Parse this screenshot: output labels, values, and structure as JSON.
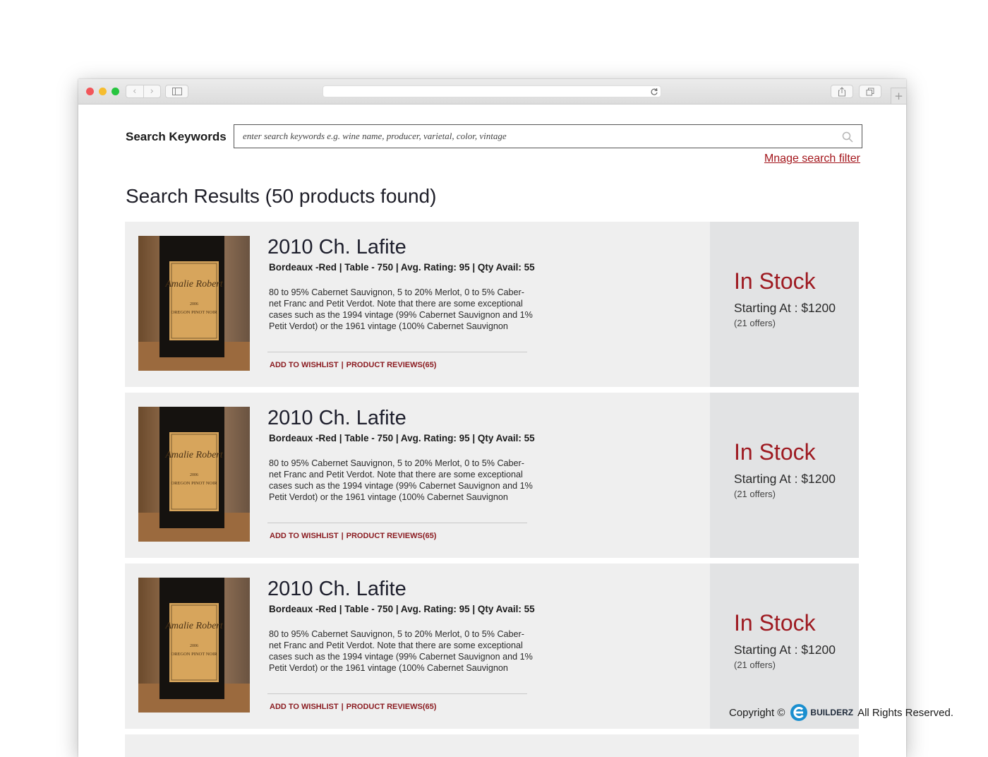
{
  "browser": {
    "controls": {
      "back": "‹",
      "forward": "›",
      "new_tab": "+"
    }
  },
  "search": {
    "label": "Search Keywords",
    "placeholder": "enter search keywords e.g. wine name, producer, varietal, color, vintage",
    "value": "",
    "manage_filter_link": "Mnage search filter"
  },
  "results": {
    "title": "Search Results (50 products found)",
    "items": [
      {
        "name": "2010 Ch. Lafite",
        "specs": "Bordeaux -Red | Table - 750 | Avg. Rating: 95 | Qty Avail: 55",
        "description": "80 to 95% Cabernet Sauvignon, 5 to 20% Merlot, 0 to 5% Caber-net Franc and Petit Verdot. Note that there are some exceptional cases such as the 1994 vintage (99% Cabernet Sauvignon and 1% Petit Verdot) or the 1961 vintage (100% Cabernet Sauvignon",
        "wishlist": "ADD TO WISHLIST",
        "separator": "|",
        "reviews": "PRODUCT REVIEWS(65)",
        "stock": "In Stock",
        "price": "Starting At : $1200",
        "offers": "(21 offers)",
        "label_brand": "Amalie Robert",
        "label_year": "2006",
        "label_line": "OREGON PINOT NOIR"
      },
      {
        "name": "2010 Ch. Lafite",
        "specs": "Bordeaux -Red | Table - 750 | Avg. Rating: 95 | Qty Avail: 55",
        "description": "80 to 95% Cabernet Sauvignon, 5 to 20% Merlot, 0 to 5% Caber-net Franc and Petit Verdot. Note that there are some exceptional cases such as the 1994 vintage (99% Cabernet Sauvignon and 1% Petit Verdot) or the 1961 vintage (100% Cabernet Sauvignon",
        "wishlist": "ADD TO WISHLIST",
        "separator": "|",
        "reviews": "PRODUCT REVIEWS(65)",
        "stock": "In Stock",
        "price": "Starting At : $1200",
        "offers": "(21 offers)",
        "label_brand": "Amalie Robert",
        "label_year": "2006",
        "label_line": "OREGON PINOT NOIR"
      },
      {
        "name": "2010 Ch. Lafite",
        "specs": "Bordeaux -Red | Table - 750 | Avg. Rating: 95 | Qty Avail: 55",
        "description": "80 to 95% Cabernet Sauvignon, 5 to 20% Merlot, 0 to 5% Caber-net Franc and Petit Verdot. Note that there are some exceptional cases such as the 1994 vintage (99% Cabernet Sauvignon and 1% Petit Verdot) or the 1961 vintage (100% Cabernet Sauvignon",
        "wishlist": "ADD TO WISHLIST",
        "separator": "|",
        "reviews": "PRODUCT REVIEWS(65)",
        "stock": "In Stock",
        "price": "Starting At : $1200",
        "offers": "(21 offers)",
        "label_brand": "Amalie Robert",
        "label_year": "2006",
        "label_line": "OREGON PINOT NOIR"
      }
    ]
  },
  "footer": {
    "copyright_prefix": "Copyright ©",
    "brand": "BUILDERZ",
    "suffix": "All Rights Reserved."
  },
  "colors": {
    "accent": "#a3151b",
    "stock": "#9e1a21",
    "card_bg": "#efefef",
    "side_bg": "#e2e3e4"
  },
  "icons": [
    "search-icon",
    "reload-icon",
    "share-icon",
    "tabs-icon",
    "sidebar-icon"
  ]
}
